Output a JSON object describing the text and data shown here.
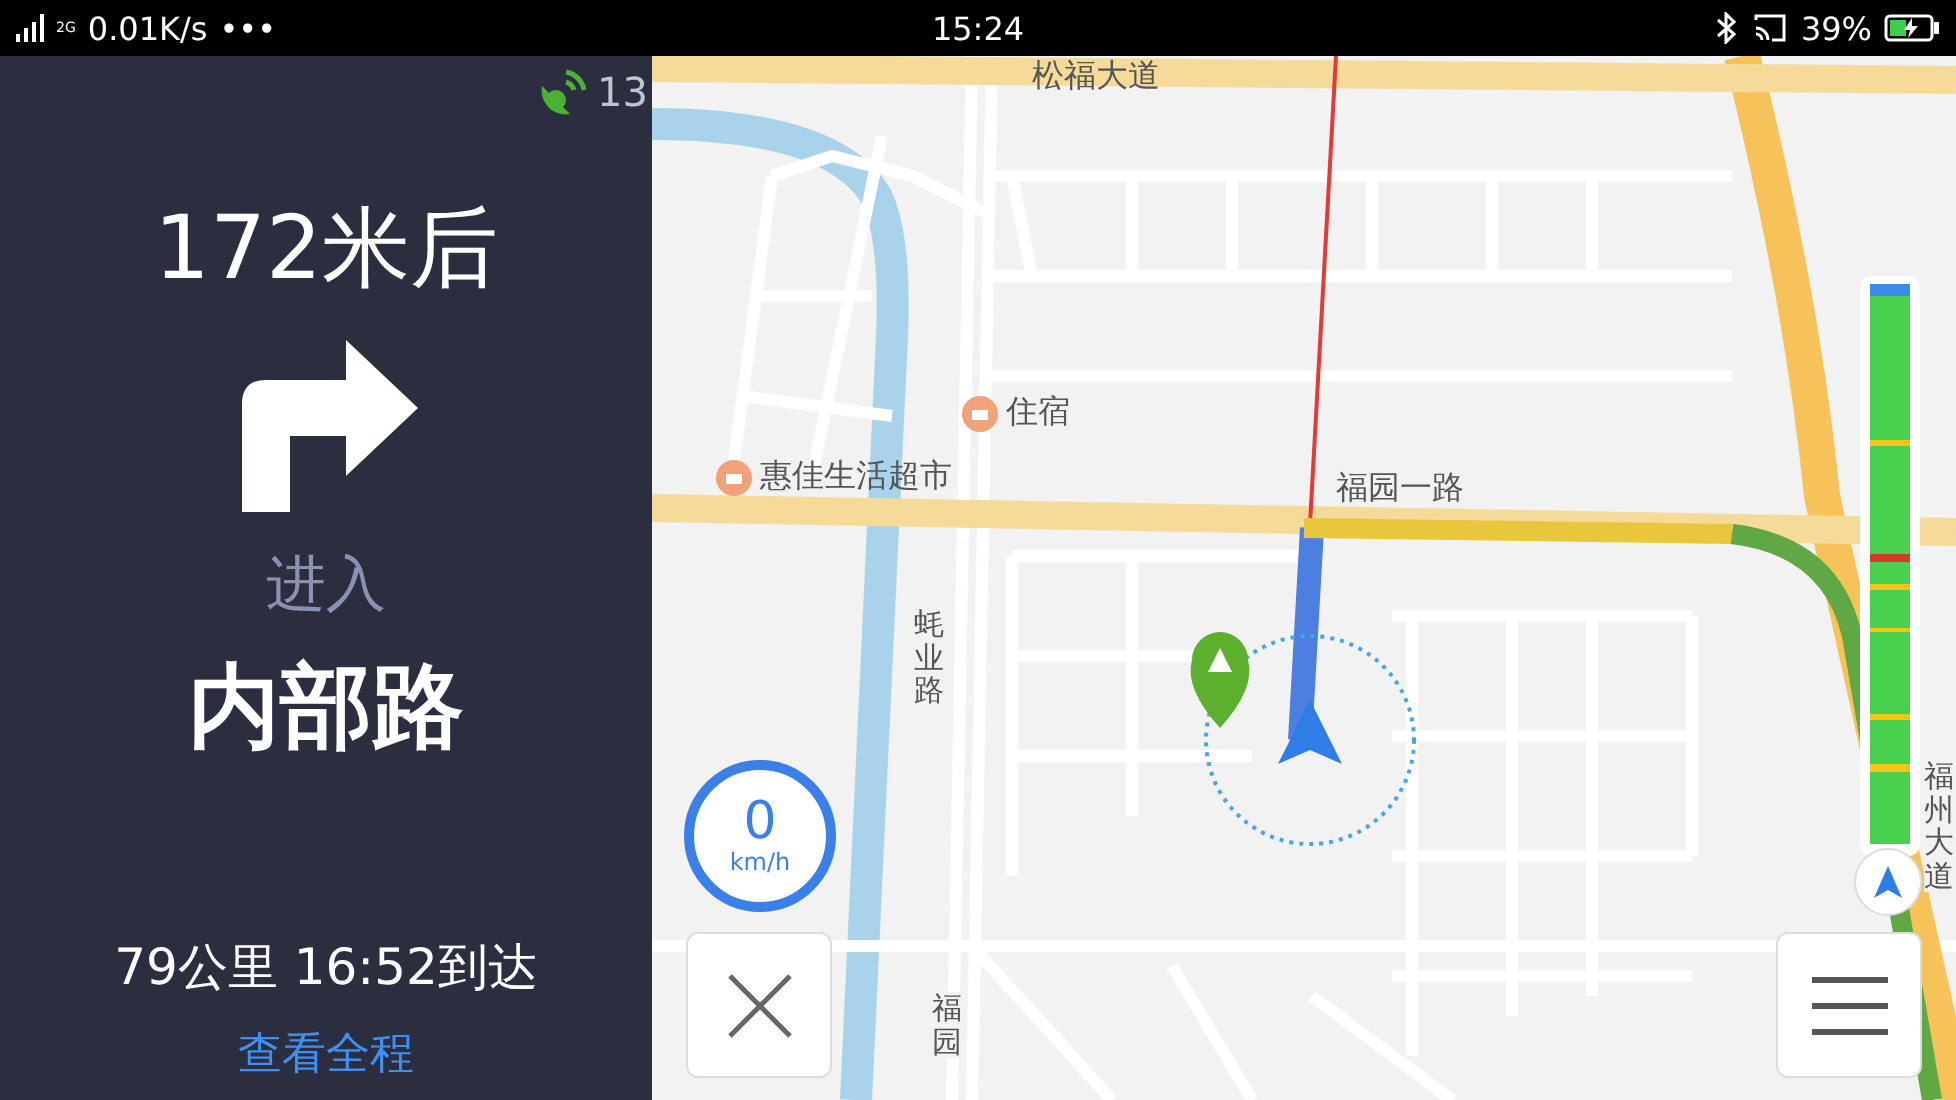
{
  "status_bar": {
    "network": "2G",
    "speed": "0.01K/s",
    "more": "•••",
    "time": "15:24",
    "battery": "39%"
  },
  "guidance": {
    "gps_count": "13",
    "distance": "172米后",
    "turn_icon": {
      "kind": "right"
    },
    "action": "进入",
    "road": "内部路",
    "summary": "79公里 16:52到达",
    "overview_link": "查看全程"
  },
  "map": {
    "labels": [
      {
        "text": "松福大道",
        "kind": "road"
      },
      {
        "text": "住宿",
        "kind": "hotel"
      },
      {
        "text": "惠佳生活超市",
        "kind": "shop"
      },
      {
        "text": "蚝业路",
        "kind": "vertical-road"
      },
      {
        "text": "福园一路",
        "kind": "road"
      },
      {
        "text": "福州大道",
        "kind": "vertical-road"
      },
      {
        "text": "福园",
        "kind": "vertical-road"
      }
    ],
    "speed": {
      "value": "0",
      "unit": "km/h"
    }
  }
}
